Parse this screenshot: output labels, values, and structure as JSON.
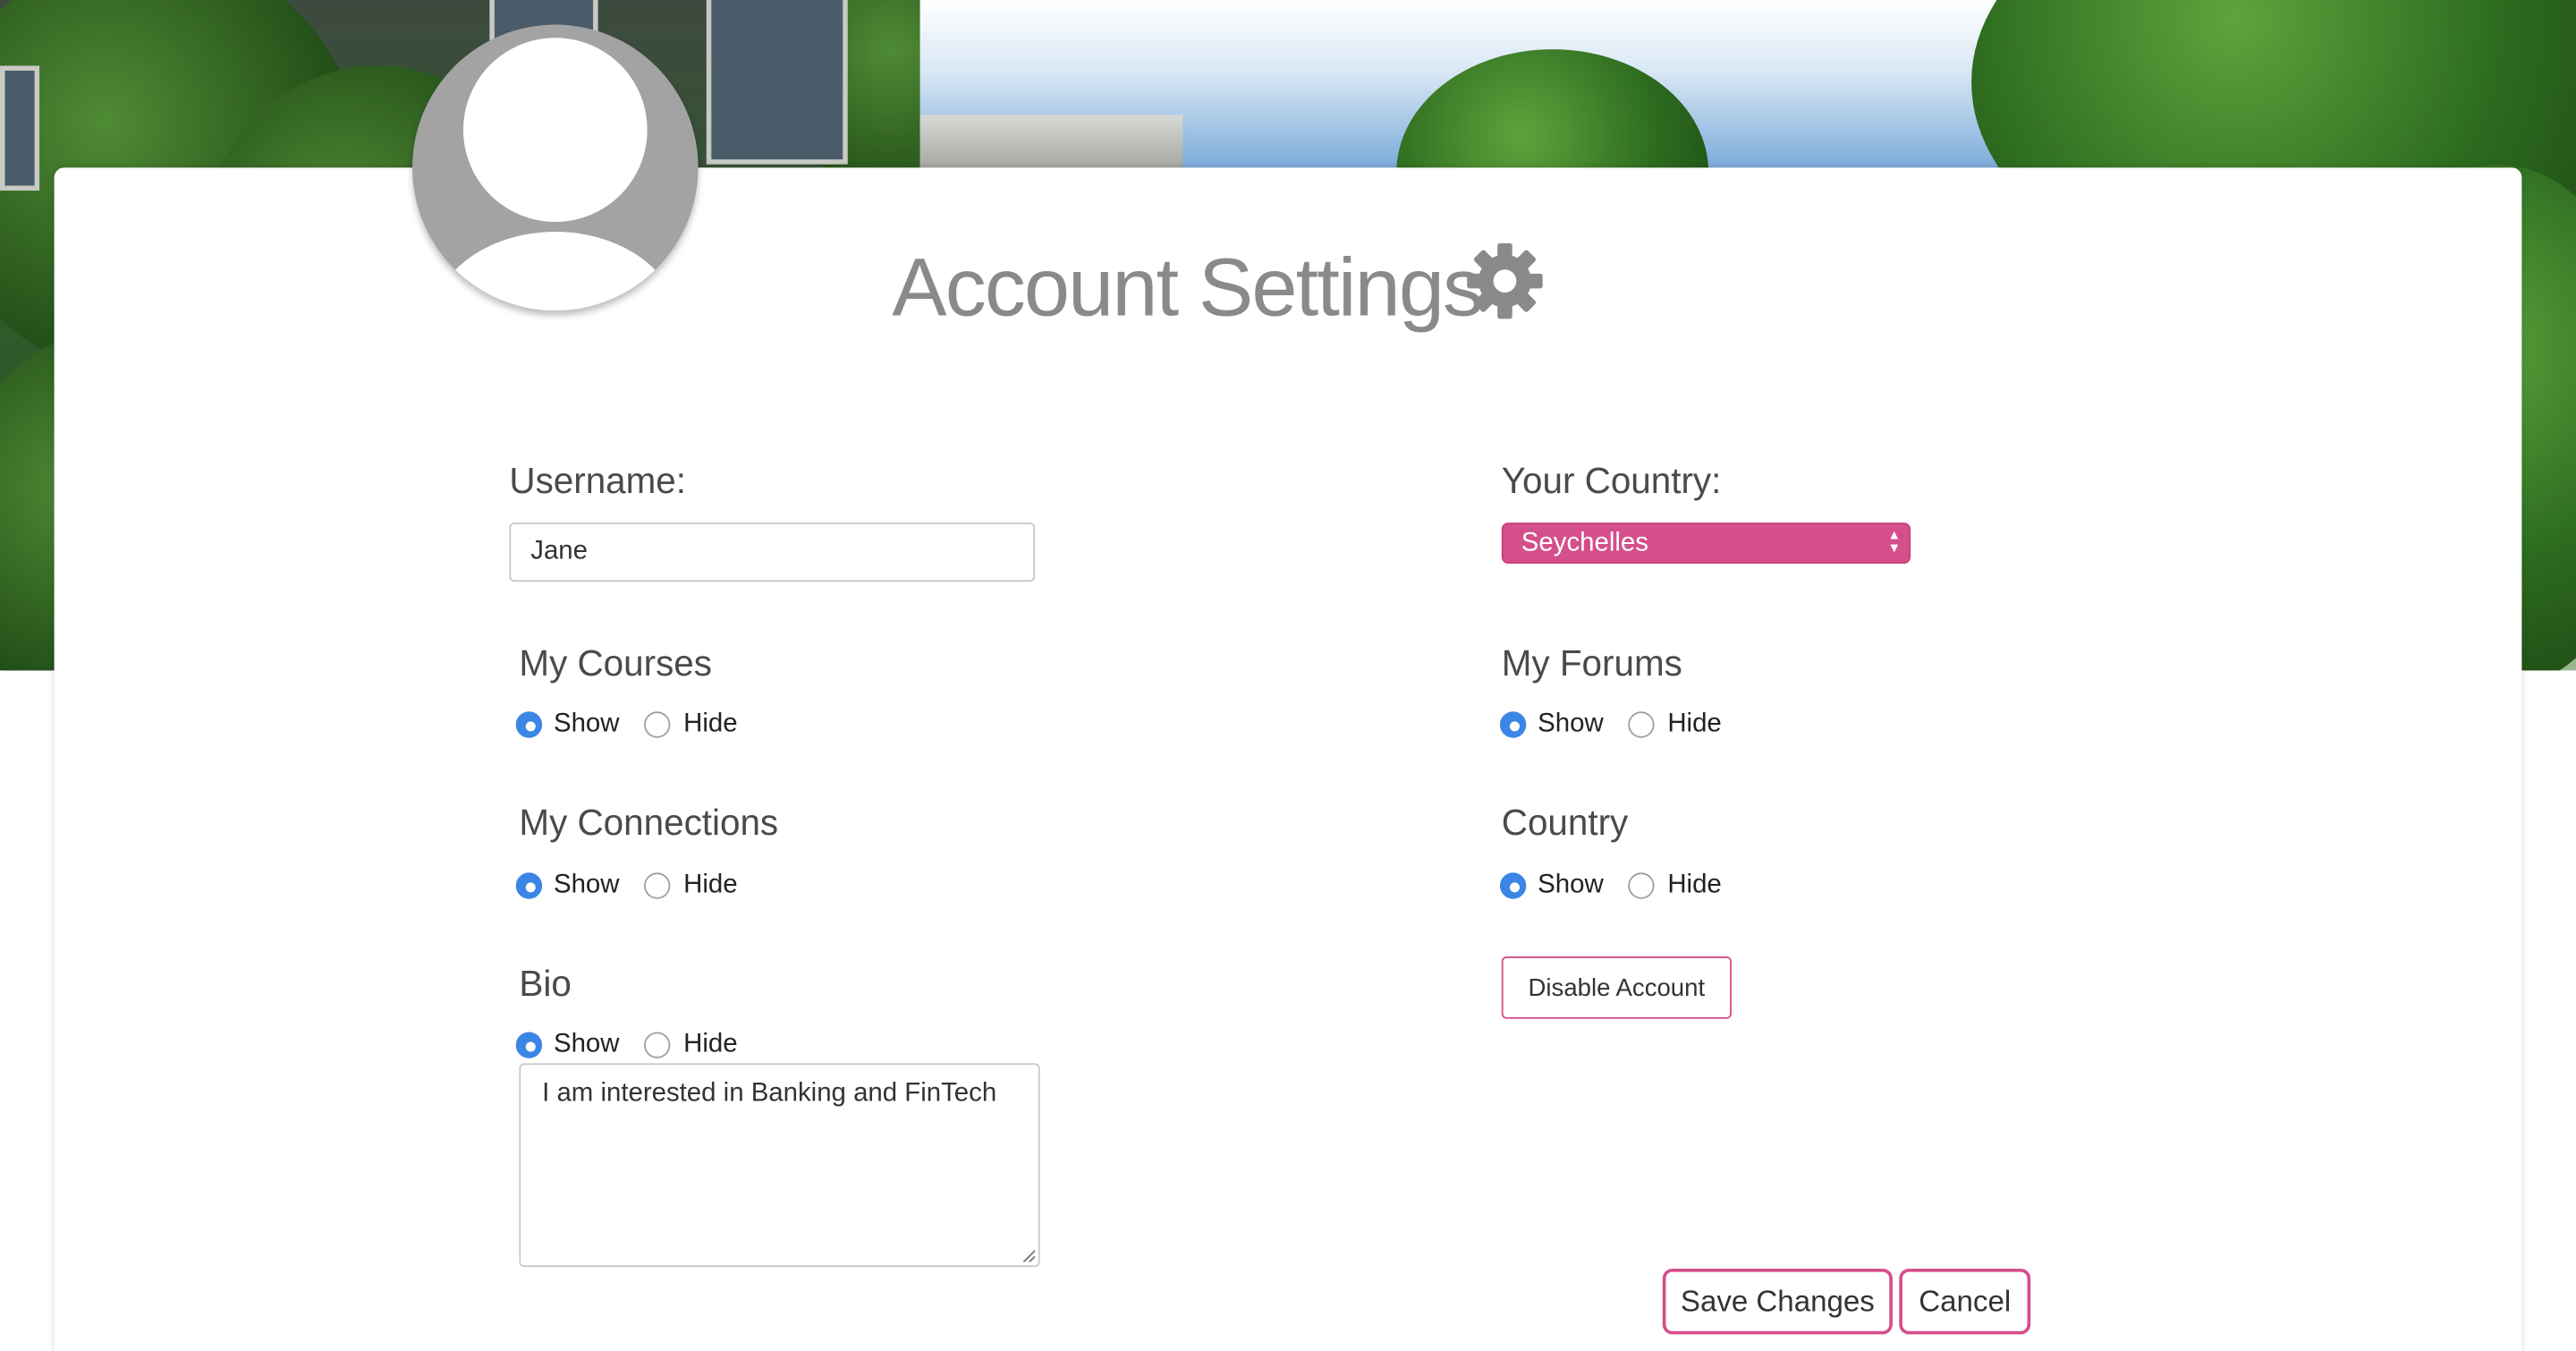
{
  "header": {
    "title": "Account Settings",
    "settings_icon": "gear-icon",
    "avatar_icon": "user-avatar-icon"
  },
  "form": {
    "username": {
      "label": "Username:",
      "value": "Jane"
    },
    "country": {
      "label": "Your Country:",
      "selected": "Seychelles"
    },
    "my_courses": {
      "label": "My Courses",
      "show_label": "Show",
      "hide_label": "Hide",
      "selected": "Show"
    },
    "my_forums": {
      "label": "My Forums",
      "show_label": "Show",
      "hide_label": "Hide",
      "selected": "Show"
    },
    "my_connections": {
      "label": "My Connections",
      "show_label": "Show",
      "hide_label": "Hide",
      "selected": "Show"
    },
    "country_visibility": {
      "label": "Country",
      "show_label": "Show",
      "hide_label": "Hide",
      "selected": "Show"
    },
    "bio": {
      "label": "Bio",
      "show_label": "Show",
      "hide_label": "Hide",
      "selected": "Show",
      "value": "I am interested in Banking and FinTech"
    }
  },
  "actions": {
    "disable_account": "Disable Account",
    "save_changes": "Save Changes",
    "cancel": "Cancel"
  },
  "colors": {
    "accent": "#d44f8b",
    "radio_selected": "#3b86e4",
    "title_text": "#8a8a8a"
  }
}
